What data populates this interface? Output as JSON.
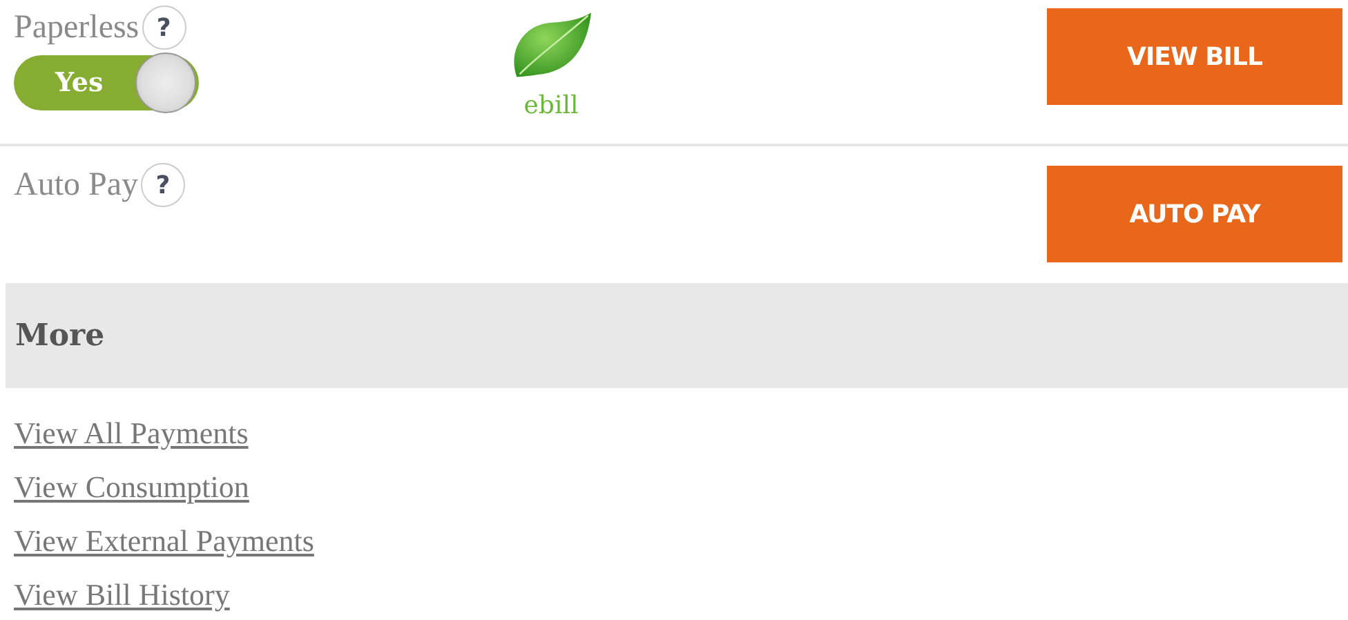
{
  "rows": [
    {
      "kind": "paperless",
      "label": "Paperless",
      "help": "?",
      "toggle": {
        "label": "Yes",
        "on": true
      },
      "badge": "ebill",
      "button": "VIEW BILL"
    },
    {
      "kind": "autopay",
      "label": "Auto Pay",
      "help": "?",
      "button": "AUTO PAY"
    }
  ],
  "more": {
    "title": "More",
    "links": [
      "View All Payments",
      "View Consumption",
      "View External Payments",
      "View Bill History"
    ]
  }
}
